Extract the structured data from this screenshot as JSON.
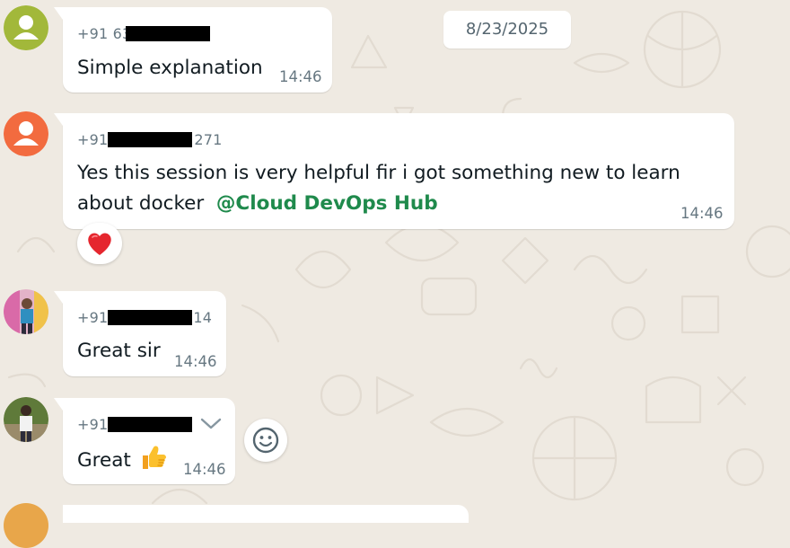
{
  "date_chip": "8/23/2025",
  "messages": [
    {
      "sender_prefix": "+91 63",
      "sender_suffix": "",
      "text": "Simple explanation",
      "time": "14:46"
    },
    {
      "sender_prefix": "+91",
      "sender_suffix": "271",
      "text_line1": "Yes this session is very helpful fir i got something new to learn",
      "text_line2": "about docker",
      "mention": "@Cloud DevOps Hub",
      "time": "14:46",
      "reaction": "red-heart"
    },
    {
      "sender_prefix": "+91",
      "sender_suffix": "14",
      "text": "Great sir",
      "time": "14:46"
    },
    {
      "sender_prefix": "+91",
      "sender_suffix": "",
      "text": "Great",
      "emoji": "thumbs-up",
      "time": "14:46"
    }
  ],
  "icons": {
    "menu_chevron": "chevron-down-icon",
    "emoji_button": "smiley-icon"
  },
  "colors": {
    "background": "#efeae2",
    "bubble": "#ffffff",
    "mention": "#1f8a4c",
    "meta_text": "#667781"
  }
}
